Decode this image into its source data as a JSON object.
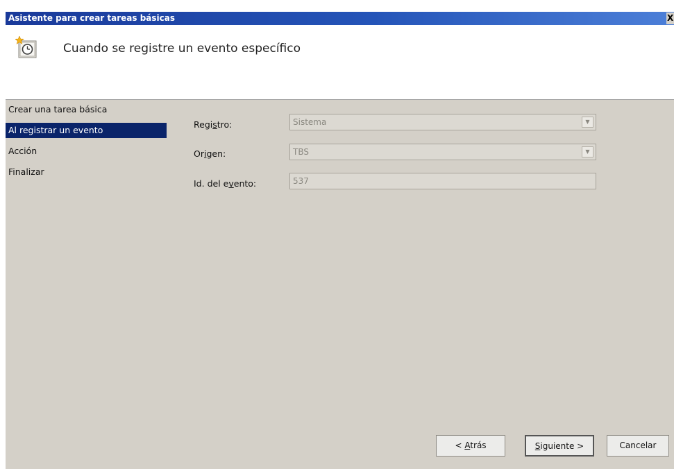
{
  "window": {
    "title": "Asistente para crear tareas básicas",
    "close_label": "X"
  },
  "header": {
    "icon": "scheduled-task-clock-icon",
    "title": "Cuando se registre un evento específico"
  },
  "steps": [
    {
      "label": "Crear una tarea básica",
      "active": false
    },
    {
      "label": "Al registrar un evento",
      "active": true
    },
    {
      "label": "Acción",
      "active": false
    },
    {
      "label": "Finalizar",
      "active": false
    }
  ],
  "form": {
    "log": {
      "label_pre": "Regi",
      "label_key": "s",
      "label_post": "tro:",
      "value": "Sistema"
    },
    "source": {
      "label_pre": "Or",
      "label_key": "i",
      "label_post": "gen:",
      "value": "TBS"
    },
    "event_id": {
      "label_pre": "Id. del e",
      "label_key": "v",
      "label_post": "ento:",
      "value": "537"
    }
  },
  "buttons": {
    "back": {
      "pre": "< ",
      "key": "A",
      "post": "trás"
    },
    "next": {
      "pre": "",
      "key": "S",
      "post": "iguiente >"
    },
    "cancel": {
      "label": "Cancelar"
    }
  },
  "colors": {
    "title_bar": "#2454b8",
    "selection": "#0a246a",
    "dialog_bg": "#d4d0c8"
  }
}
